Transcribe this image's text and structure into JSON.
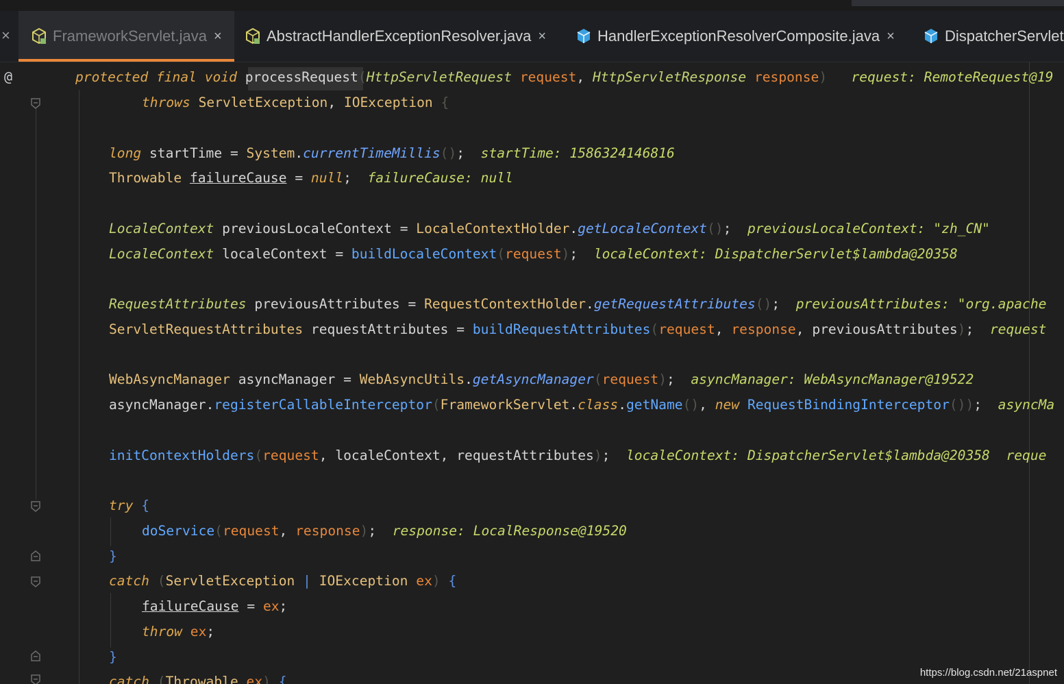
{
  "tabs": [
    {
      "label": "FrameworkServlet.java",
      "active": true,
      "icon": "java-class-icon"
    },
    {
      "label": "AbstractHandlerExceptionResolver.java",
      "active": false,
      "icon": "java-class-icon"
    },
    {
      "label": "HandlerExceptionResolverComposite.java",
      "active": false,
      "icon": "java-class-icon"
    },
    {
      "label": "DispatcherServlet",
      "active": false,
      "icon": "java-class-icon"
    }
  ],
  "close_glyph": "×",
  "gutter": {
    "annotation_glyph": "@"
  },
  "code": {
    "l1": {
      "mods": "protected final void",
      "name": "processRequest",
      "open": "(",
      "t1": "HttpServletRequest",
      "p1": "request",
      "comma": ",",
      "t2": "HttpServletResponse",
      "p2": "response",
      "close": ")",
      "hint": "request: RemoteRequest@19"
    },
    "l2": {
      "throws": "throws",
      "e1": "ServletException",
      "comma": ",",
      "e2": "IOException",
      "brace": "{"
    },
    "l3": {
      "type": "long",
      "var": "startTime",
      "eq": "=",
      "cls": "System",
      "dot": ".",
      "method": "currentTimeMillis",
      "parens": "()",
      "semi": ";",
      "hint": "startTime: 1586324146816"
    },
    "l4": {
      "type": "Throwable",
      "var": "failureCause",
      "eq": "=",
      "val": "null",
      "semi": ";",
      "hint": "failureCause: null"
    },
    "l5": {
      "type": "LocaleContext",
      "var": "previousLocaleContext",
      "eq": "=",
      "cls": "LocaleContextHolder",
      "dot": ".",
      "method": "getLocaleContext",
      "parens": "()",
      "semi": ";",
      "hint": "previousLocaleContext: \"zh_CN\""
    },
    "l6": {
      "type": "LocaleContext",
      "var": "localeContext",
      "eq": "=",
      "method": "buildLocaleContext",
      "open": "(",
      "arg": "request",
      "close": ")",
      "semi": ";",
      "hint": "localeContext: DispatcherServlet$lambda@20358"
    },
    "l7": {
      "type": "RequestAttributes",
      "var": "previousAttributes",
      "eq": "=",
      "cls": "RequestContextHolder",
      "dot": ".",
      "method": "getRequestAttributes",
      "parens": "()",
      "semi": ";",
      "hint": "previousAttributes: \"org.apache"
    },
    "l8": {
      "type": "ServletRequestAttributes",
      "var": "requestAttributes",
      "eq": "=",
      "method": "buildRequestAttributes",
      "open": "(",
      "a1": "request",
      "c1": ",",
      "a2": "response",
      "c2": ",",
      "a3": "previousAttributes",
      "close": ")",
      "semi": ";",
      "hint": "request"
    },
    "l9": {
      "type": "WebAsyncManager",
      "var": "asyncManager",
      "eq": "=",
      "cls": "WebAsyncUtils",
      "dot": ".",
      "method": "getAsyncManager",
      "open": "(",
      "arg": "request",
      "close": ")",
      "semi": ";",
      "hint": "asyncManager: WebAsyncManager@19522"
    },
    "l10": {
      "obj": "asyncManager",
      "dot": ".",
      "method": "registerCallableInterceptor",
      "open": "(",
      "cls": "FrameworkServlet",
      "dot2": ".",
      "kwclass": "class",
      "dot3": ".",
      "getname": "getName",
      "parens": "()",
      "comma": ",",
      "newkw": "new",
      "ctor": "RequestBindingInterceptor",
      "parens2": "()",
      "close": ")",
      "semi": ";",
      "hint": "asyncMa"
    },
    "l11": {
      "method": "initContextHolders",
      "open": "(",
      "a1": "request",
      "c1": ",",
      "a2": "localeContext",
      "c2": ",",
      "a3": "requestAttributes",
      "close": ")",
      "semi": ";",
      "hint": "localeContext: DispatcherServlet$lambda@20358",
      "hint2": "reque"
    },
    "l12": {
      "kw": "try",
      "brace": "{"
    },
    "l13": {
      "method": "doService",
      "open": "(",
      "a1": "request",
      "c1": ",",
      "a2": "response",
      "close": ")",
      "semi": ";",
      "hint": "response: LocalResponse@19520"
    },
    "l14": {
      "brace": "}"
    },
    "l15": {
      "kw": "catch",
      "open": "(",
      "e1": "ServletException",
      "bar": "|",
      "e2": "IOException",
      "ex": "ex",
      "close": ")",
      "brace": "{"
    },
    "l16": {
      "var": "failureCause",
      "eq": "=",
      "val": "ex",
      "semi": ";"
    },
    "l17": {
      "kw": "throw",
      "val": "ex",
      "semi": ";"
    },
    "l18": {
      "brace": "}"
    },
    "l19": {
      "kw": "catch",
      "open": "(",
      "e1": "Throwable",
      "ex": "ex",
      "close": ")",
      "brace": "{"
    }
  },
  "watermark": "https://blog.csdn.net/21aspnet"
}
